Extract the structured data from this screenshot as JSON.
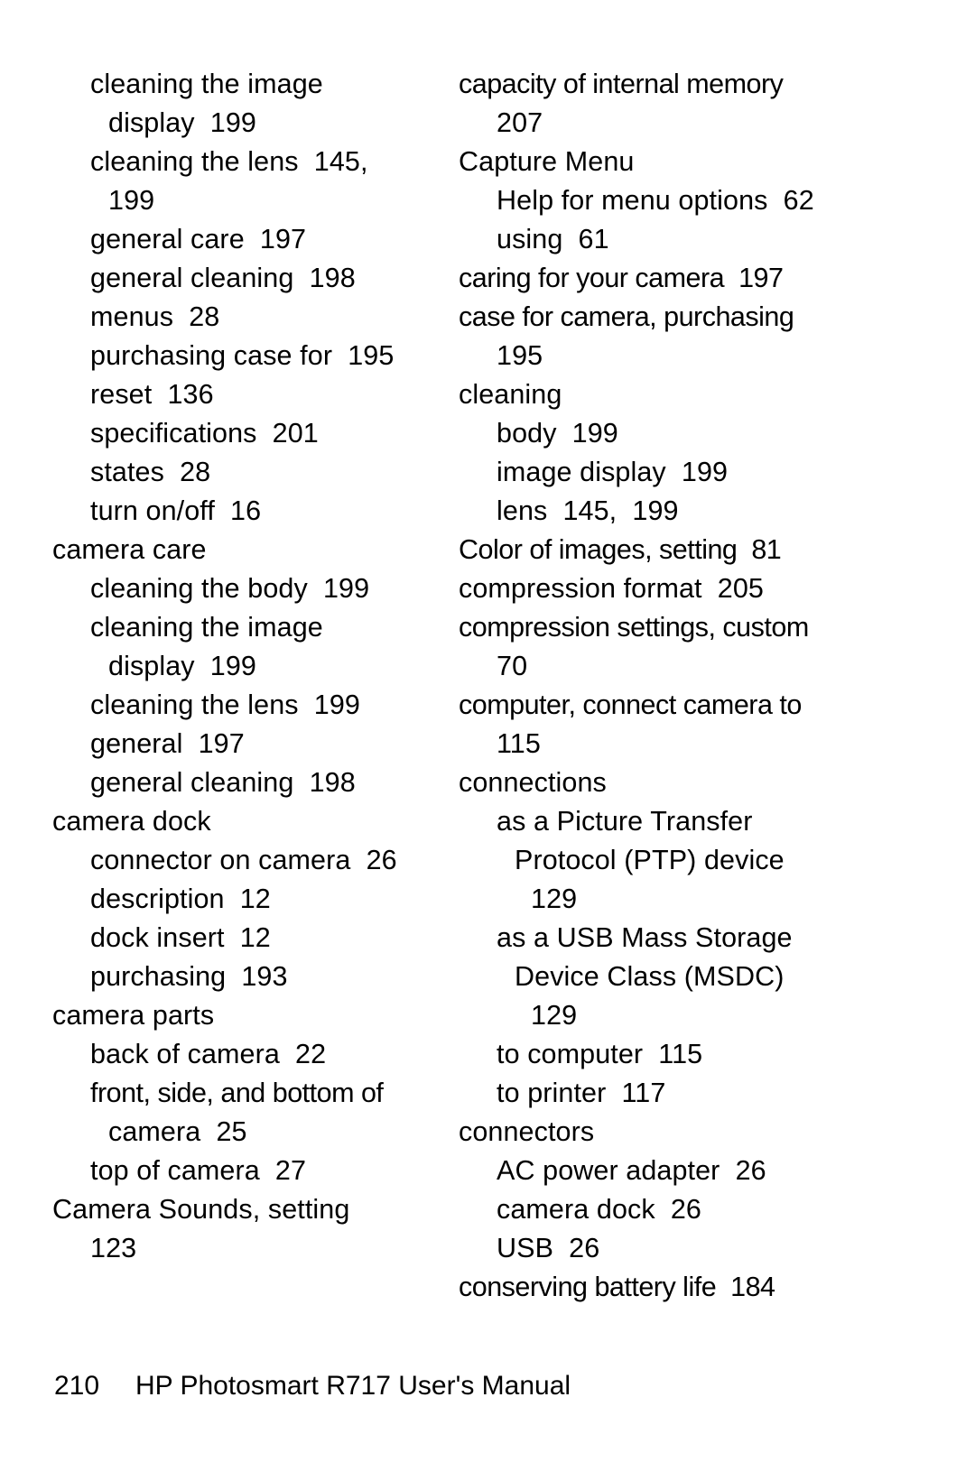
{
  "document": {
    "title": "HP Photosmart R717 User's Manual",
    "page_number": "210",
    "section": "index"
  },
  "footer": {
    "page_number": "210",
    "manual_title": "HP Photosmart R717 User's Manual"
  },
  "columns": {
    "left": [
      {
        "text": "cleaning the image",
        "level": 1
      },
      {
        "text": "display  199",
        "level": 2
      },
      {
        "text": "cleaning the lens  145,",
        "level": 1
      },
      {
        "text": "199",
        "level": 2
      },
      {
        "text": "general care  197",
        "level": 1
      },
      {
        "text": "general cleaning  198",
        "level": 1
      },
      {
        "text": "menus  28",
        "level": 1
      },
      {
        "text": "purchasing case for  195",
        "level": 1
      },
      {
        "text": "reset  136",
        "level": 1
      },
      {
        "text": "specifications  201",
        "level": 1
      },
      {
        "text": "states  28",
        "level": 1
      },
      {
        "text": "turn on/off  16",
        "level": 1
      },
      {
        "text": "camera care",
        "level": 0
      },
      {
        "text": "cleaning the body  199",
        "level": 1
      },
      {
        "text": "cleaning the image",
        "level": 1
      },
      {
        "text": "display  199",
        "level": 2
      },
      {
        "text": "cleaning the lens  199",
        "level": 1
      },
      {
        "text": "general  197",
        "level": 1
      },
      {
        "text": "general cleaning  198",
        "level": 1
      },
      {
        "text": "camera dock",
        "level": 0
      },
      {
        "text": "connector on camera  26",
        "level": 1
      },
      {
        "text": "description  12",
        "level": 1
      },
      {
        "text": "dock insert  12",
        "level": 1
      },
      {
        "text": "purchasing  193",
        "level": 1
      },
      {
        "text": "camera parts",
        "level": 0
      },
      {
        "text": "back of camera  22",
        "level": 1
      },
      {
        "text": "front, side, and bottom of",
        "level": 1
      },
      {
        "text": "camera  25",
        "level": 2
      },
      {
        "text": "top of camera  27",
        "level": 1
      },
      {
        "text": "Camera Sounds, setting",
        "level": 0
      },
      {
        "text": "123",
        "level": 1
      }
    ],
    "right": [
      {
        "text": "capacity of internal memory",
        "level": 0
      },
      {
        "text": "207",
        "level": 1
      },
      {
        "text": "Capture Menu",
        "level": 0
      },
      {
        "text": "Help for menu options  62",
        "level": 1
      },
      {
        "text": "using  61",
        "level": 1
      },
      {
        "text": "caring for your camera  197",
        "level": 0
      },
      {
        "text": "case for camera, purchasing",
        "level": 0
      },
      {
        "text": "195",
        "level": 1
      },
      {
        "text": "cleaning",
        "level": 0
      },
      {
        "text": "body  199",
        "level": 1
      },
      {
        "text": "image display  199",
        "level": 1
      },
      {
        "text": "lens  145,  199",
        "level": 1
      },
      {
        "text": "Color of images, setting  81",
        "level": 0
      },
      {
        "text": "compression format  205",
        "level": 0
      },
      {
        "text": "compression settings, custom",
        "level": 0
      },
      {
        "text": "70",
        "level": 1
      },
      {
        "text": "computer, connect camera to",
        "level": 0
      },
      {
        "text": "115",
        "level": 1
      },
      {
        "text": "connections",
        "level": 0
      },
      {
        "text": "as a Picture Transfer",
        "level": 1
      },
      {
        "text": "Protocol (PTP) device",
        "level": 2
      },
      {
        "text": "129",
        "level": 3
      },
      {
        "text": "as a USB Mass Storage",
        "level": 1
      },
      {
        "text": "Device Class (MSDC)",
        "level": 2
      },
      {
        "text": "129",
        "level": 3
      },
      {
        "text": "to computer  115",
        "level": 1
      },
      {
        "text": "to printer  117",
        "level": 1
      },
      {
        "text": "connectors",
        "level": 0
      },
      {
        "text": "AC power adapter  26",
        "level": 1
      },
      {
        "text": "camera dock  26",
        "level": 1
      },
      {
        "text": "USB  26",
        "level": 1
      },
      {
        "text": "conserving battery life  184",
        "level": 0
      }
    ]
  }
}
